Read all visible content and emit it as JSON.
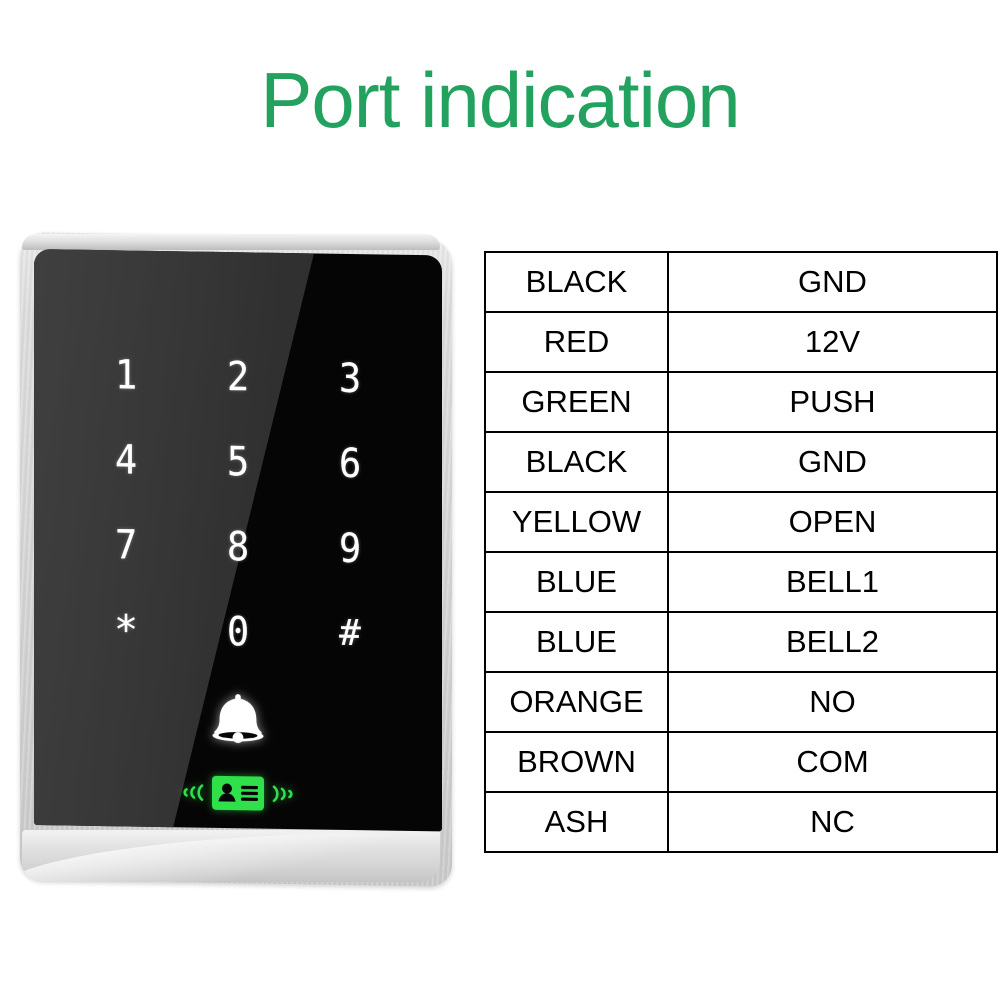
{
  "page": {
    "title": "Port indication",
    "title_color": "#23a15e",
    "background": "#ffffff"
  },
  "device": {
    "name": "rfid-keypad-access-controller",
    "body_color": "#d8d8d8",
    "panel_color": "#050505",
    "keypad": {
      "keys": [
        {
          "label": "1",
          "kind": "digit"
        },
        {
          "label": "2",
          "kind": "digit"
        },
        {
          "label": "3",
          "kind": "digit"
        },
        {
          "label": "4",
          "kind": "digit"
        },
        {
          "label": "5",
          "kind": "digit"
        },
        {
          "label": "6",
          "kind": "digit"
        },
        {
          "label": "7",
          "kind": "digit"
        },
        {
          "label": "8",
          "kind": "digit"
        },
        {
          "label": "9",
          "kind": "digit"
        },
        {
          "label": "*",
          "kind": "star"
        },
        {
          "label": "0",
          "kind": "digit"
        },
        {
          "label": "#",
          "kind": "hash"
        }
      ]
    },
    "indicators": {
      "bell_icon": "bell-icon",
      "bell_color": "#ffffff",
      "card_icon": "rfid-card-icon",
      "card_color": "#2fe04a",
      "wave_left_icon": "signal-wave-left-icon",
      "wave_right_icon": "signal-wave-right-icon"
    }
  },
  "table": {
    "columns": [
      "wire_color",
      "function"
    ],
    "rows": [
      {
        "wire_color": "BLACK",
        "function": "GND"
      },
      {
        "wire_color": "RED",
        "function": "12V"
      },
      {
        "wire_color": "GREEN",
        "function": "PUSH"
      },
      {
        "wire_color": "BLACK",
        "function": "GND"
      },
      {
        "wire_color": "YELLOW",
        "function": "OPEN"
      },
      {
        "wire_color": "BLUE",
        "function": "BELL1"
      },
      {
        "wire_color": "BLUE",
        "function": "BELL2"
      },
      {
        "wire_color": "ORANGE",
        "function": "NO"
      },
      {
        "wire_color": "BROWN",
        "function": "COM"
      },
      {
        "wire_color": "ASH",
        "function": "NC"
      }
    ]
  }
}
